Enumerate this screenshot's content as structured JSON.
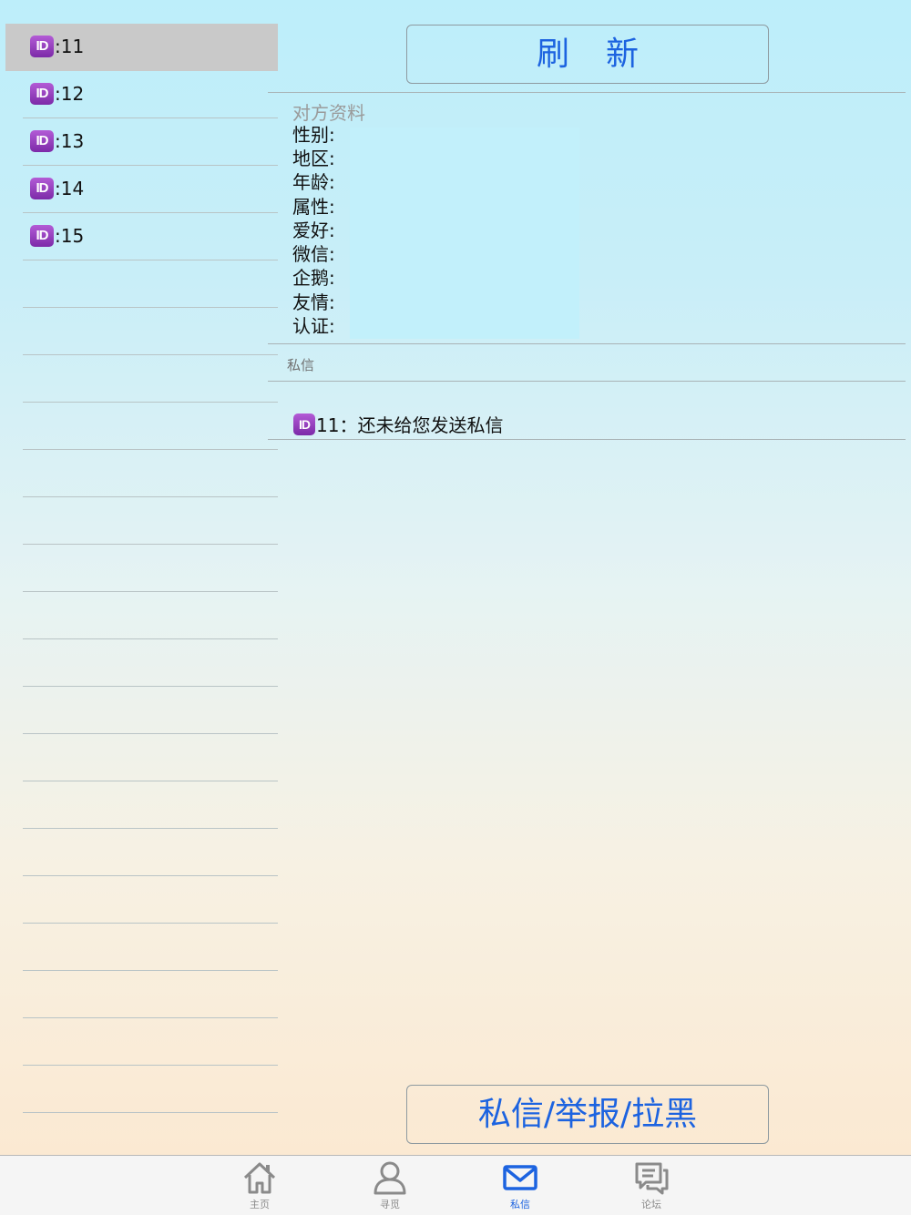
{
  "sidebar": {
    "badge_text": "ID",
    "items": [
      {
        "label": ":11"
      },
      {
        "label": ":12"
      },
      {
        "label": ":13"
      },
      {
        "label": ":14"
      },
      {
        "label": ":15"
      }
    ],
    "empty_rows": 18
  },
  "header": {
    "refresh_label": "刷新"
  },
  "profile": {
    "heading": "对方资料",
    "fields": [
      {
        "label": "性别:"
      },
      {
        "label": "地区:"
      },
      {
        "label": "年龄:"
      },
      {
        "label": "属性:"
      },
      {
        "label": "爱好:"
      },
      {
        "label": "微信:"
      },
      {
        "label": "企鹅:"
      },
      {
        "label": "友情:"
      },
      {
        "label": "认证:"
      }
    ]
  },
  "messages": {
    "heading": "私信",
    "items": [
      {
        "badge": "ID",
        "text": "11：还未给您发送私信"
      }
    ]
  },
  "footer": {
    "action_label": "私信/举报/拉黑"
  },
  "tabbar": {
    "tabs": [
      {
        "label": "主页",
        "icon": "home-icon",
        "active": false
      },
      {
        "label": "寻觅",
        "icon": "person-icon",
        "active": false
      },
      {
        "label": "私信",
        "icon": "mail-icon",
        "active": true
      },
      {
        "label": "论坛",
        "icon": "forum-icon",
        "active": false
      }
    ]
  },
  "colors": {
    "accent": "#1c63e0",
    "badge": "#8a35b8",
    "selected_row": "#c9c9c9",
    "profile_box": "#c2f0fb"
  }
}
